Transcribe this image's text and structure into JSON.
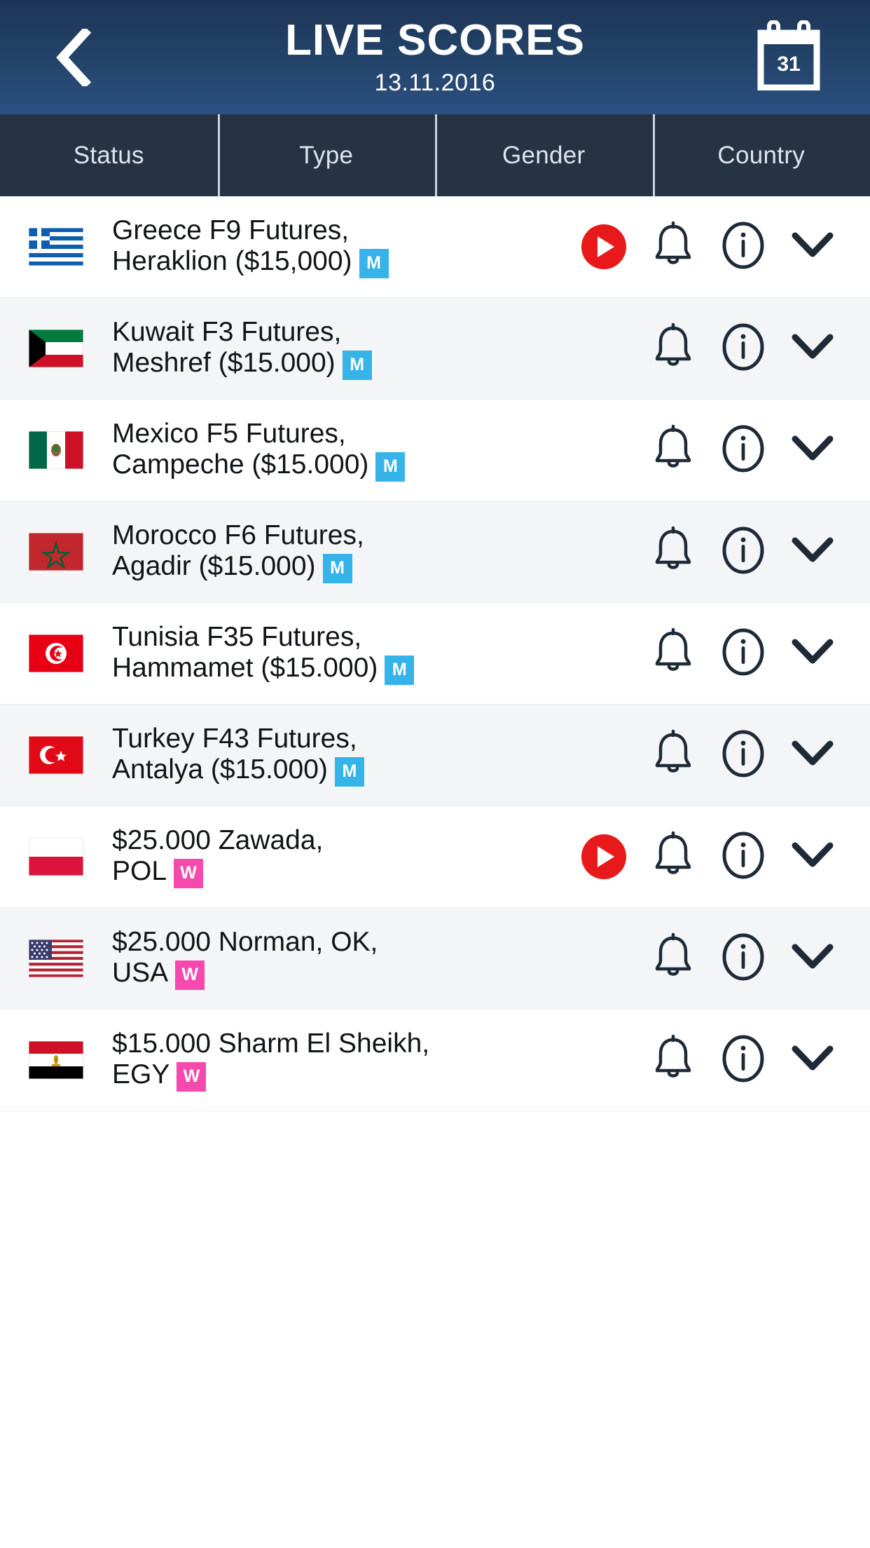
{
  "header": {
    "back_icon": "chevron-left-icon",
    "title": "LIVE SCORES",
    "date": "13.11.2016",
    "calendar_icon": "calendar-icon",
    "calendar_day": "31"
  },
  "filters": {
    "tabs": [
      {
        "label": "Status"
      },
      {
        "label": "Type"
      },
      {
        "label": "Gender"
      },
      {
        "label": "Country"
      }
    ]
  },
  "colors": {
    "header_top": "#1d3557",
    "header_bottom": "#2b5080",
    "filterbar": "#263345",
    "badge_men": "#36b3e8",
    "badge_women": "#f549ae",
    "play_red": "#e8191b",
    "icon_dark": "#1f2a37",
    "row_alt": "#f4f5f6"
  },
  "icons": {
    "bell": "bell-icon",
    "info": "info-circle-icon",
    "chevron": "chevron-down-icon",
    "play": "play-icon"
  },
  "tournaments": [
    {
      "flag": "greece-flag",
      "line1": "Greece F9 Futures,",
      "line2": "Heraklion ($15,000)",
      "badge": "M",
      "badge_type": "m",
      "has_play": true
    },
    {
      "flag": "kuwait-flag",
      "line1": "Kuwait F3 Futures,",
      "line2": "Meshref ($15.000)",
      "badge": "M",
      "badge_type": "m",
      "has_play": false
    },
    {
      "flag": "mexico-flag",
      "line1": "Mexico F5 Futures,",
      "line2": "Campeche ($15.000)",
      "badge": "M",
      "badge_type": "m",
      "has_play": false
    },
    {
      "flag": "morocco-flag",
      "line1": "Morocco F6 Futures,",
      "line2": "Agadir ($15.000)",
      "badge": "M",
      "badge_type": "m",
      "has_play": false
    },
    {
      "flag": "tunisia-flag",
      "line1": "Tunisia F35 Futures,",
      "line2": "Hammamet ($15.000)",
      "badge": "M",
      "badge_type": "m",
      "has_play": false
    },
    {
      "flag": "turkey-flag",
      "line1": "Turkey F43 Futures,",
      "line2": "Antalya ($15.000)",
      "badge": "M",
      "badge_type": "m",
      "has_play": false
    },
    {
      "flag": "poland-flag",
      "line1": "$25.000 Zawada,",
      "line2": "POL",
      "badge": "W",
      "badge_type": "w",
      "has_play": true
    },
    {
      "flag": "usa-flag",
      "line1": "$25.000 Norman, OK,",
      "line2": "USA",
      "badge": "W",
      "badge_type": "w",
      "has_play": false
    },
    {
      "flag": "egypt-flag",
      "line1": "$15.000 Sharm El Sheikh,",
      "line2": "EGY",
      "badge": "W",
      "badge_type": "w",
      "has_play": false
    }
  ]
}
